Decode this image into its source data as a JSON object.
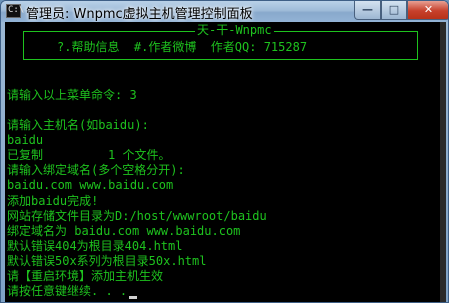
{
  "window": {
    "title": "管理员:  Wnpmc虚拟主机管理控制面板",
    "icon_text": "C:\\",
    "minimize": "—",
    "maximize": "□",
    "close": "✕"
  },
  "console": {
    "banner_title": "天-干-Wnpmc",
    "banner_menu": "?.帮助信息  #.作者微博  作者QQ: 715287",
    "lines": [
      "请输入以上菜单命令: 3",
      "",
      "请输入主机名(如baidu):",
      "baidu",
      "已复制         1 个文件。",
      "请输入绑定域名(多个空格分开):",
      "baidu.com www.baidu.com",
      "添加baidu完成!",
      "网站存储文件目录为D:/host/wwwroot/baidu",
      "绑定域名为 baidu.com www.baidu.com",
      "默认错误404为根目录404.html",
      "默认错误50x系列为根目录50x.html",
      "请【重启环境】添加主机生效",
      "请按任意键继续. . ."
    ]
  }
}
